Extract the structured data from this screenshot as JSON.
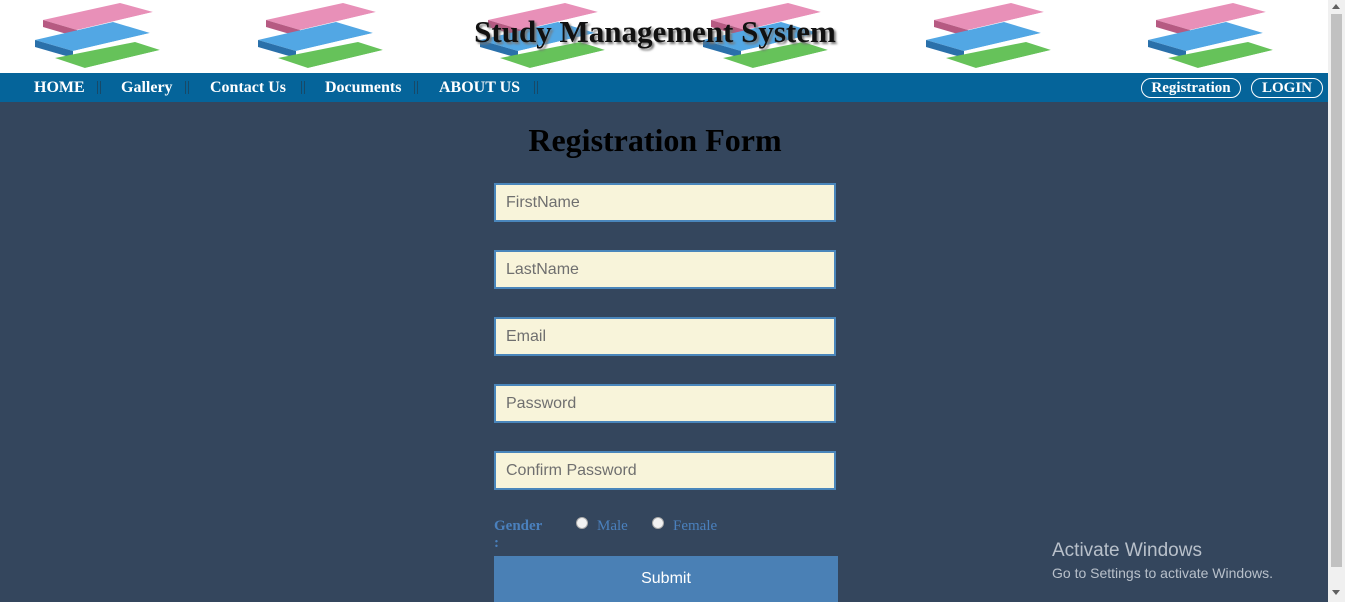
{
  "site": {
    "title": "Study Management System"
  },
  "nav": {
    "items": [
      {
        "label": "HOME"
      },
      {
        "label": "Gallery"
      },
      {
        "label": "Contact Us"
      },
      {
        "label": "Documents"
      },
      {
        "label": "ABOUT US"
      }
    ],
    "separator": "||",
    "registration_label": "Registration",
    "login_label": "LOGIN"
  },
  "form": {
    "title": "Registration Form",
    "fields": {
      "firstname": {
        "placeholder": "FirstName",
        "value": ""
      },
      "lastname": {
        "placeholder": "LastName",
        "value": ""
      },
      "email": {
        "placeholder": "Email",
        "value": ""
      },
      "password": {
        "placeholder": "Password",
        "value": ""
      },
      "confirm_password": {
        "placeholder": "Confirm Password",
        "value": ""
      }
    },
    "gender": {
      "label": "Gender :",
      "options": [
        "Male",
        "Female"
      ],
      "selected": null
    },
    "submit_label": "Submit"
  },
  "watermark": {
    "title": "Activate Windows",
    "subtitle": "Go to Settings to activate Windows."
  },
  "colors": {
    "page_bg": "#34465d",
    "nav_bg": "#05649a",
    "field_bg": "#f8f4da",
    "field_border": "#4a86bb",
    "button_bg": "#4a80b5",
    "gender_text": "#4a80bd"
  },
  "icons": {
    "header_decoration": "book-stack-icon",
    "radio": "radio-button"
  }
}
